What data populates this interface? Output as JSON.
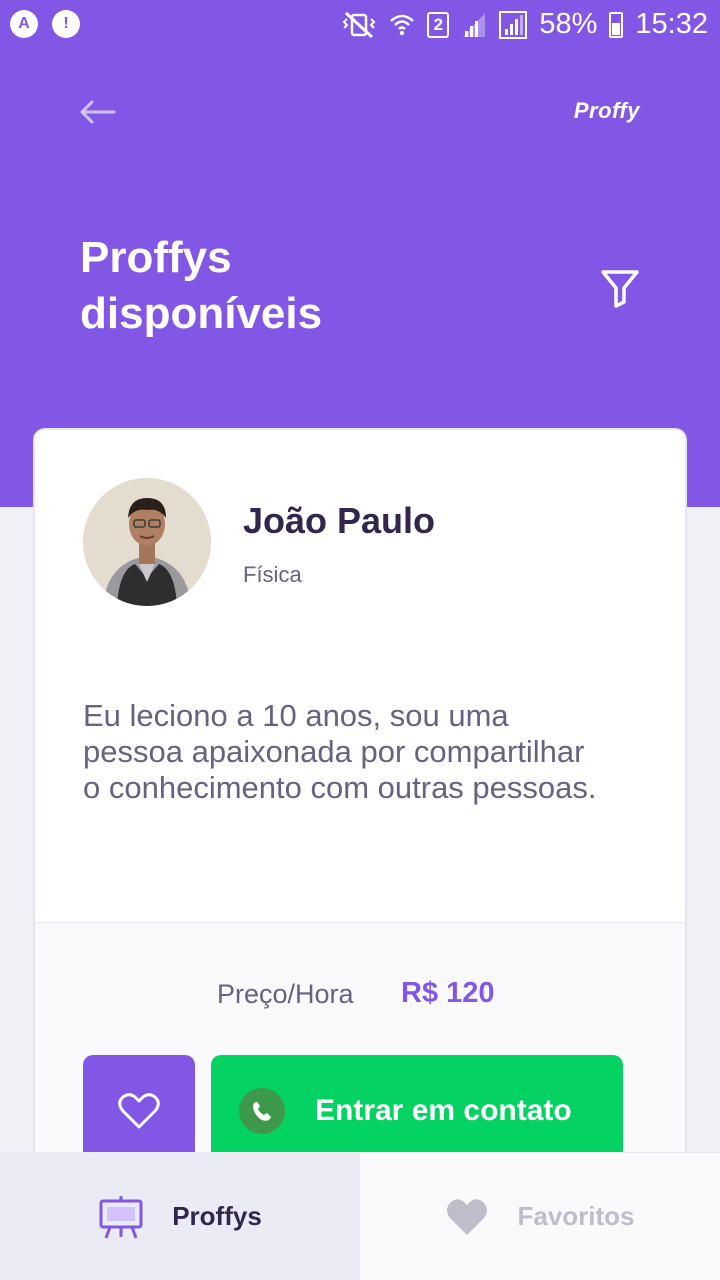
{
  "status_bar": {
    "app_badge": "A",
    "sim_slot": "2",
    "battery_percent": "58%",
    "time": "15:32"
  },
  "header": {
    "brand": "Proffy",
    "title": "Proffys disponíveis"
  },
  "teacher": {
    "name": "João Paulo",
    "subject": "Física",
    "bio": "Eu leciono a 10 anos, sou uma pessoa apaixonada por compartilhar o conhecimento com outras pessoas.",
    "price_label": "Preço/Hora",
    "price_value": "R$ 120",
    "contact_label": "Entrar em contato"
  },
  "tabs": [
    {
      "label": "Proffys",
      "icon": "easel-icon",
      "active": true
    },
    {
      "label": "Favoritos",
      "icon": "heart-icon",
      "active": false
    }
  ],
  "colors": {
    "primary": "#8257E5",
    "secondary": "#04D361",
    "title_text": "#32264D",
    "body_text": "#6A6180",
    "inactive_text": "#C1BCCC"
  }
}
